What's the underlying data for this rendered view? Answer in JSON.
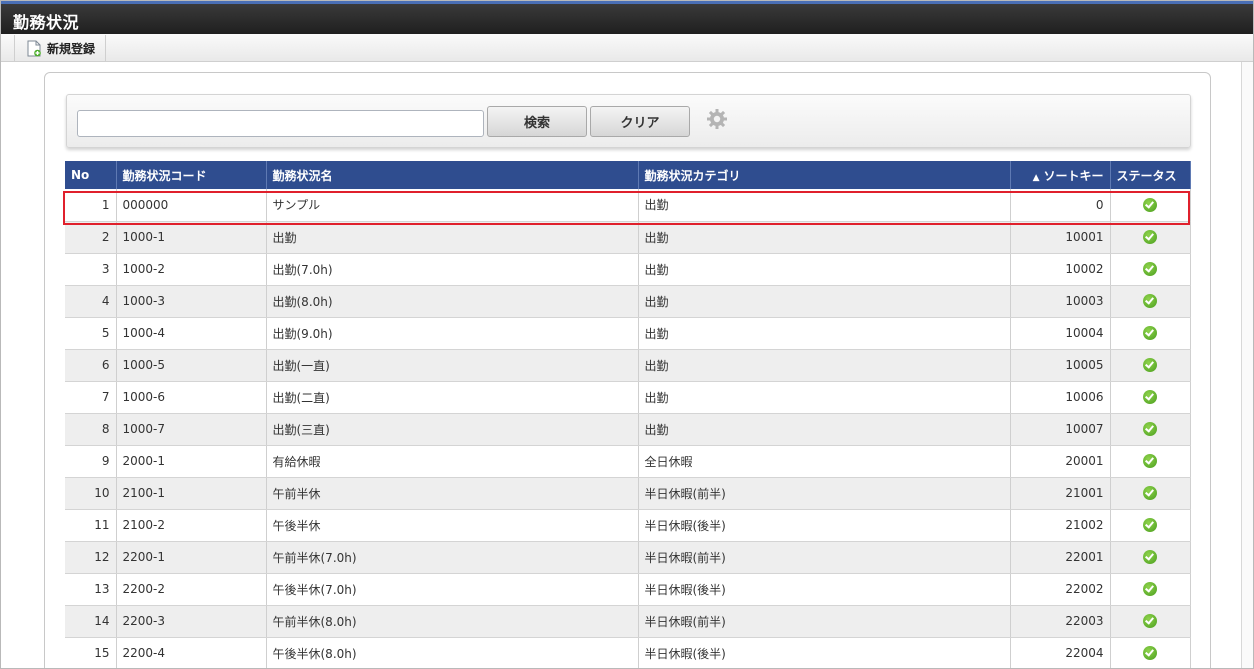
{
  "header": {
    "title": "勤務状況"
  },
  "toolbar": {
    "new_label": "新規登録"
  },
  "search": {
    "value": "",
    "placeholder": "",
    "search_label": "検索",
    "clear_label": "クリア"
  },
  "table": {
    "columns": {
      "no": "No",
      "code": "勤務状況コード",
      "name": "勤務状況名",
      "category": "勤務状況カテゴリ",
      "sort_arrow": "▲",
      "sort": "ソートキー",
      "status": "ステータス"
    },
    "rows": [
      {
        "no": "1",
        "code": "000000",
        "name": "サンプル",
        "category": "出勤",
        "sort": "0"
      },
      {
        "no": "2",
        "code": "1000-1",
        "name": "出勤",
        "category": "出勤",
        "sort": "10001"
      },
      {
        "no": "3",
        "code": "1000-2",
        "name": "出勤(7.0h)",
        "category": "出勤",
        "sort": "10002"
      },
      {
        "no": "4",
        "code": "1000-3",
        "name": "出勤(8.0h)",
        "category": "出勤",
        "sort": "10003"
      },
      {
        "no": "5",
        "code": "1000-4",
        "name": "出勤(9.0h)",
        "category": "出勤",
        "sort": "10004"
      },
      {
        "no": "6",
        "code": "1000-5",
        "name": "出勤(一直)",
        "category": "出勤",
        "sort": "10005"
      },
      {
        "no": "7",
        "code": "1000-6",
        "name": "出勤(二直)",
        "category": "出勤",
        "sort": "10006"
      },
      {
        "no": "8",
        "code": "1000-7",
        "name": "出勤(三直)",
        "category": "出勤",
        "sort": "10007"
      },
      {
        "no": "9",
        "code": "2000-1",
        "name": "有給休暇",
        "category": "全日休暇",
        "sort": "20001"
      },
      {
        "no": "10",
        "code": "2100-1",
        "name": "午前半休",
        "category": "半日休暇(前半)",
        "sort": "21001"
      },
      {
        "no": "11",
        "code": "2100-2",
        "name": "午後半休",
        "category": "半日休暇(後半)",
        "sort": "21002"
      },
      {
        "no": "12",
        "code": "2200-1",
        "name": "午前半休(7.0h)",
        "category": "半日休暇(前半)",
        "sort": "22001"
      },
      {
        "no": "13",
        "code": "2200-2",
        "name": "午後半休(7.0h)",
        "category": "半日休暇(後半)",
        "sort": "22002"
      },
      {
        "no": "14",
        "code": "2200-3",
        "name": "午前半休(8.0h)",
        "category": "半日休暇(前半)",
        "sort": "22003"
      },
      {
        "no": "15",
        "code": "2200-4",
        "name": "午後半休(8.0h)",
        "category": "半日休暇(後半)",
        "sort": "22004"
      }
    ]
  },
  "icons": {
    "new": "new-document-icon",
    "settings": "gear-icon",
    "status": "check-circle-icon"
  },
  "colors": {
    "header_bg": "#2f4d8f",
    "highlight": "#e0202c",
    "status_ok": "#5cb52a",
    "titlebar": "#262626"
  }
}
